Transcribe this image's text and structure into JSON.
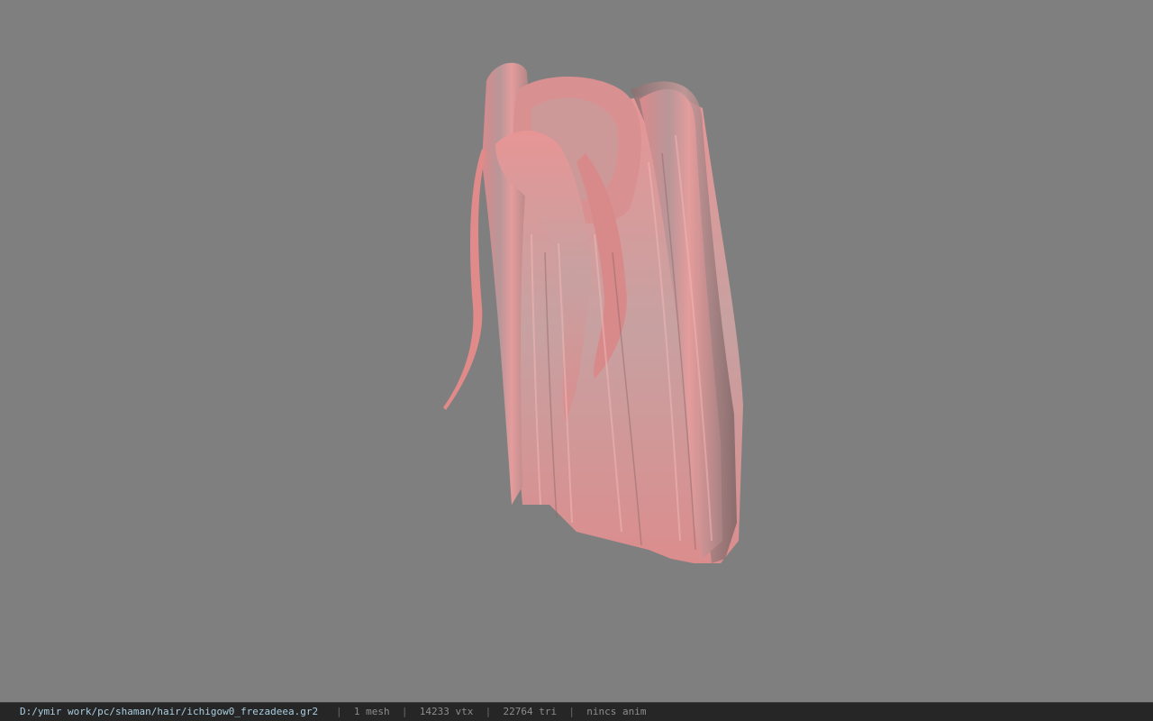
{
  "viewport": {
    "background": "#7f7f7f",
    "model_icon": "hair-mesh-render",
    "model_color": "#e08a8a"
  },
  "status": {
    "path": "D:/ymir work/pc/shaman/hair/ichigow0_frezadeea.gr2",
    "separator": "|",
    "mesh": "1 mesh",
    "vtx": "14233 vtx",
    "tri": "22764 tri",
    "anim": "nincs anim"
  }
}
